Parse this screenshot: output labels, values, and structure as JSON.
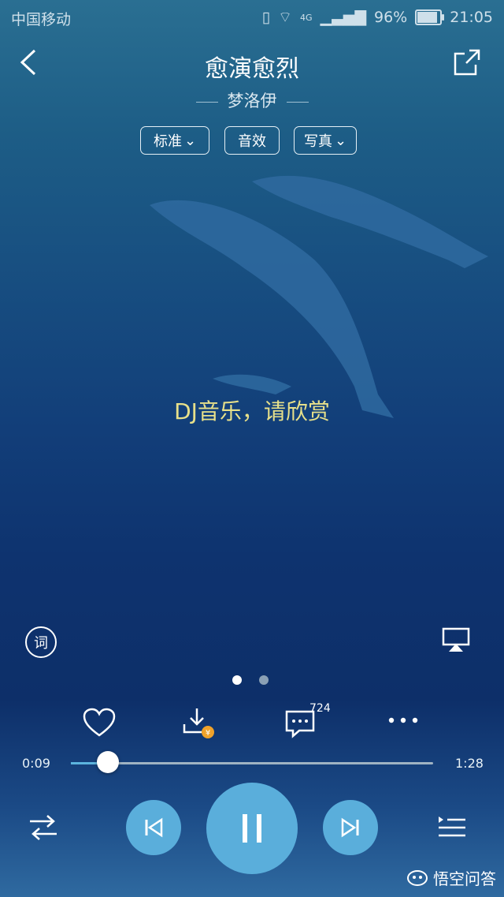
{
  "status_bar": {
    "carrier": "中国移动",
    "network": "4G",
    "battery": "96%",
    "battery_level": 0.96,
    "time": "21:05"
  },
  "header": {
    "back_icon": "chevron-left-icon",
    "title": "愈演愈烈",
    "artist": "梦洛伊",
    "share_icon": "share-icon"
  },
  "options": {
    "quality": "标准",
    "effect": "音效",
    "photo": "写真"
  },
  "lyric": "DJ音乐，请欣赏",
  "side_controls": {
    "lyrics_icon_text": "词",
    "cast_icon": "airplay-icon"
  },
  "pager": {
    "count": 2,
    "active": 0
  },
  "actions": {
    "like_icon": "heart-icon",
    "download_icon": "download-icon",
    "comment_icon": "comment-icon",
    "comment_count": "724",
    "more_icon": "more-icon"
  },
  "progress": {
    "current": "0:09",
    "total": "1:28",
    "fraction": 0.102
  },
  "player": {
    "mode_icon": "shuffle-icon",
    "prev_icon": "previous-icon",
    "play_pause_icon": "pause-icon",
    "next_icon": "next-icon",
    "playlist_icon": "playlist-icon"
  },
  "watermark": "悟空问答",
  "colors": {
    "accent": "#5aaedb",
    "lyric": "#e7e08a",
    "coin_badge": "#f0a22a"
  }
}
